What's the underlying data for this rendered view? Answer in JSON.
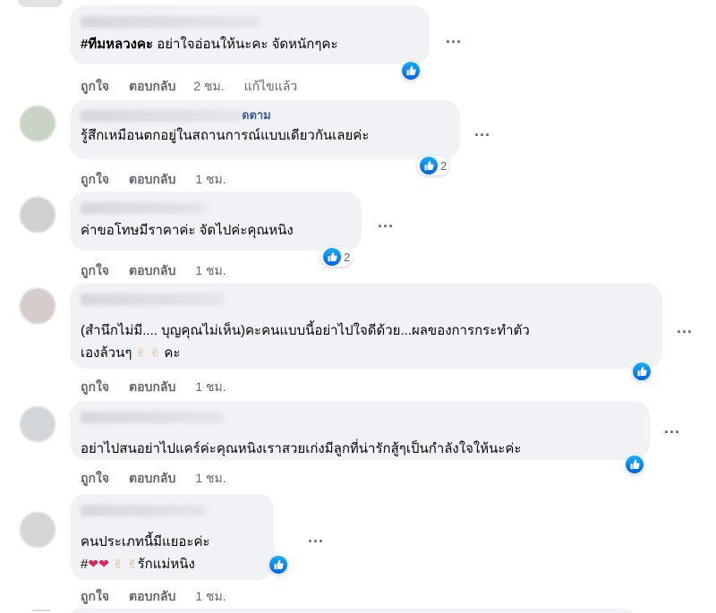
{
  "actions": {
    "like": "ถูกใจ",
    "reply": "ตอบกลับ",
    "more": "..."
  },
  "comments": [
    {
      "text_hashtag": "#ทีมหลวงคะ",
      "text": " อย่าใจอ่อนให้นะคะ จัดหนักๆคะ",
      "time": "2 ชม.",
      "edited": "แก้ไขแล้ว",
      "reactions": ""
    },
    {
      "author_tail": "ดตาม",
      "text": "รู้สึกเหมือนตกอยู่ในสถานการณ์แบบเดียวกันเลยค่ะ",
      "time": "1 ชม.",
      "reactions": "2"
    },
    {
      "text": "ค่าขอโทษมีราคาค่ะ จัดไปค่ะคุณหนิง",
      "time": "1 ชม.",
      "reactions": "2"
    },
    {
      "text": "(สำนึกไม่มี.... บุญคุณไม่เห็น)คะคนแบบนี้อย่าไปใจดีด้วย...ผลของการกระทำตัว",
      "text_line2": "เองล้วนๆ",
      "text_line2_tail": " คะ",
      "time": "1 ชม.",
      "reactions": ""
    },
    {
      "text": "อย่าไปสนอย่าไปแคร์ค่ะคุณหนิงเราสวยเก่งมีลูกที่น่ารักสู้ๆเป็นกำลังใจให้นะค่ะ",
      "time": "1 ชม.",
      "reactions": ""
    },
    {
      "text": "คนประเภทนี้มีแยอะค่ะ",
      "text_line2_prefix": "#",
      "text_line2_tail": "รักแม่หนิง",
      "time": "1 ชม.",
      "reactions": ""
    }
  ],
  "colors": {
    "bubble": "#f0f2f5",
    "meta": "#65676b",
    "like_blue": "#1877f2",
    "author_link": "#385898"
  },
  "icons": [
    "like-icon",
    "more-options-icon",
    "heart-emoji",
    "victory-hand-emoji"
  ]
}
